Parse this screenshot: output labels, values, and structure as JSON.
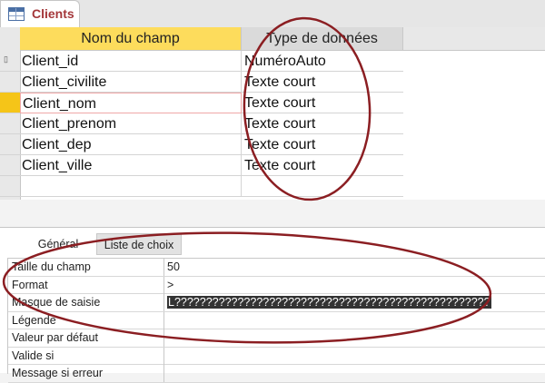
{
  "document_tab": {
    "title": "Clients",
    "icon": "table-icon"
  },
  "design_grid": {
    "headers": {
      "field_name": "Nom du champ",
      "data_type": "Type de données"
    },
    "rows": [
      {
        "name": "Client_id",
        "type": "NuméroAuto"
      },
      {
        "name": "Client_civilite",
        "type": "Texte court"
      },
      {
        "name": "Client_nom",
        "type": "Texte court"
      },
      {
        "name": "Client_prenom",
        "type": "Texte court"
      },
      {
        "name": "Client_dep",
        "type": "Texte court"
      },
      {
        "name": "Client_ville",
        "type": "Texte court"
      }
    ],
    "current_row_index": 2
  },
  "properties": {
    "tabs": {
      "general": "Général",
      "lookup": "Liste de choix"
    },
    "rows": [
      {
        "label": "Taille du champ",
        "value": "50"
      },
      {
        "label": "Format",
        "value": ">"
      },
      {
        "label": "Masque de saisie",
        "value": "L??????????????????????????????????????????????????"
      },
      {
        "label": "Légende",
        "value": ""
      },
      {
        "label": "Valeur par défaut",
        "value": ""
      },
      {
        "label": "Valide si",
        "value": ""
      },
      {
        "label": "Message si erreur",
        "value": ""
      }
    ]
  },
  "colors": {
    "accent_title": "#a4373a",
    "header_highlight": "#fddc5c",
    "annotation_ring": "#8b1e22"
  }
}
